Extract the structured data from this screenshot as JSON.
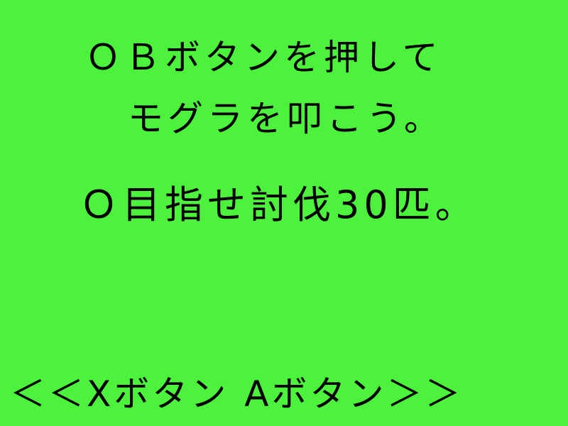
{
  "instructions": {
    "line1": "ＯＢボタンを押して",
    "line2": "モグラを叩こう。"
  },
  "goal": "Ｏ目指せ討伐30匹。",
  "navigation": {
    "left_arrows": "＜＜",
    "left_label": "Xボタン",
    "right_label": "Aボタン",
    "right_arrows": "＞＞"
  },
  "colors": {
    "background": "#4cf23c",
    "text": "#000000"
  }
}
